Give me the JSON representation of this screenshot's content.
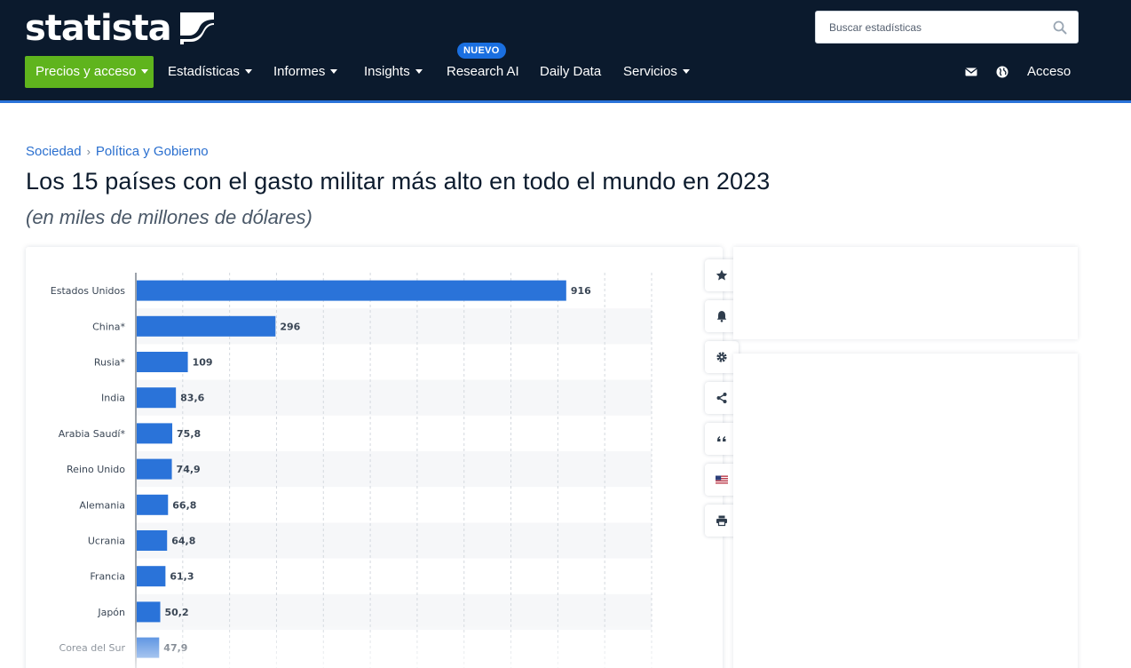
{
  "header": {
    "logo_text": "statista",
    "search_placeholder": "Buscar estadísticas",
    "nav": {
      "pricing": "Precios y acceso",
      "statistics": "Estadísticas",
      "reports": "Informes",
      "insights": "Insights",
      "research_ai": "Research AI",
      "new_badge": "NUEVO",
      "daily_data": "Daily Data",
      "services": "Servicios",
      "login": "Acceso"
    },
    "colors": {
      "background": "#0b1a2d",
      "pricing": "#5fb41d",
      "badge": "#1a6fe0",
      "accent_line": "#2a73d9"
    }
  },
  "breadcrumb": [
    "Sociedad",
    "Política y Gobierno"
  ],
  "title": "Los 15 países con el gasto militar más alto en todo el mundo en 2023",
  "subtitle": "(en miles de millones de dólares)",
  "toolbar": [
    "star-icon",
    "bell-icon",
    "gear-icon",
    "share-icon",
    "quote-icon",
    "us-flag-icon",
    "print-icon"
  ],
  "chart_data": {
    "type": "bar",
    "orientation": "horizontal",
    "categories": [
      "Estados Unidos",
      "China*",
      "Rusia*",
      "India",
      "Arabia Saudí*",
      "Reino Unido",
      "Alemania",
      "Ucrania",
      "Francia",
      "Japón",
      "Corea del Sur"
    ],
    "values": [
      916,
      296,
      109,
      83.6,
      75.8,
      74.9,
      66.8,
      64.8,
      61.3,
      50.2,
      47.9
    ],
    "value_labels": [
      "916",
      "296",
      "109",
      "83,6",
      "75,8",
      "74,9",
      "66,8",
      "64,8",
      "61,3",
      "50,2",
      "47,9"
    ],
    "xlim": [
      0,
      1100
    ],
    "grid_interval": 100,
    "grid": true,
    "bar_color": "#2a73d9",
    "title": "",
    "xlabel": "",
    "ylabel": ""
  }
}
